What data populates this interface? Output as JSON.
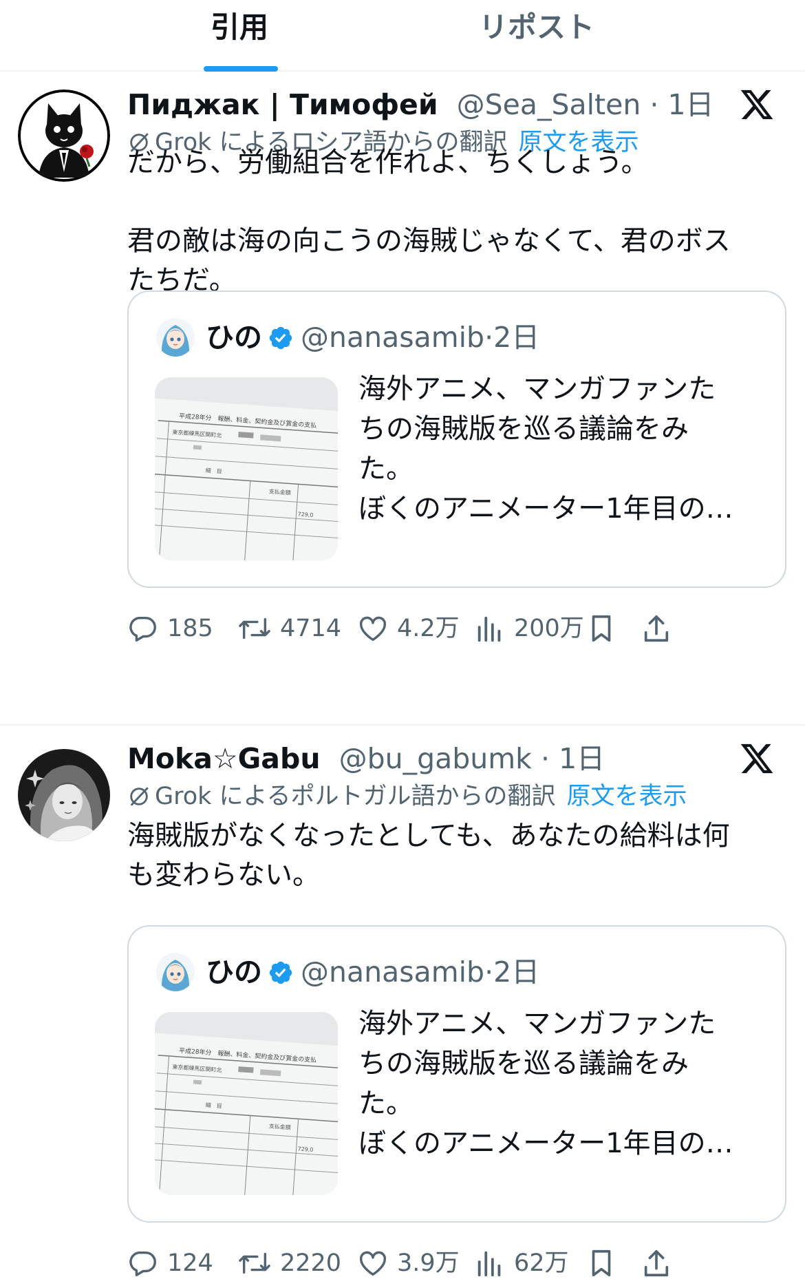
{
  "tabs": [
    {
      "label": "引用",
      "active": true
    },
    {
      "label": "リポスト",
      "active": false
    }
  ],
  "colors": {
    "accent": "#1d9bf0",
    "text": "#0f1419",
    "muted": "#536471",
    "border": "#cfd9de"
  },
  "posts": [
    {
      "display_name": "Пиджак | Тимофей",
      "handle": "@Sea_Salten",
      "dot": "·",
      "time": "1日",
      "avatar_icon": "black-cat-in-suit-avatar",
      "translation_note": "Grok によるロシア語からの翻訳",
      "show_original": "原文を表示",
      "text": "だから、労働組合を作れよ、ちくしょう。\n\n君の敵は海の向こうの海賊じゃなくて、君のボス\nたちだ。",
      "quote": {
        "name": "ひの",
        "handle": "@nanasamib",
        "dot": "·",
        "time": "2日",
        "text": "海外アニメ、マンガファンた\nちの海賊版を巡る議論をみ\nた。\nぼくのアニメーター1年目の…",
        "thumb_lines": [
          "平成28年分　報酬、料金、契約金及び賞金の支払",
          "東京都練馬区関町北",
          "細　目",
          "支払金額",
          "729,0"
        ]
      },
      "stats": {
        "replies": "185",
        "reposts": "4714",
        "likes": "4.2万",
        "views": "200万"
      }
    },
    {
      "display_name": "Moka☆Gabu",
      "handle": "@bu_gabumk",
      "dot": "·",
      "time": "1日",
      "avatar_icon": "illustrated-girl-avatar",
      "translation_note": "Grok によるポルトガル語からの翻訳",
      "show_original": "原文を表示",
      "text": "海賊版がなくなったとしても、あなたの給料は何\nも変わらない。",
      "quote": {
        "name": "ひの",
        "handle": "@nanasamib",
        "dot": "·",
        "time": "2日",
        "text": "海外アニメ、マンガファンた\nちの海賊版を巡る議論をみ\nた。\nぼくのアニメーター1年目の…",
        "thumb_lines": [
          "平成28年分　報酬、料金、契約金及び賞金の支払",
          "東京都練馬区関町北",
          "細　目",
          "支払金額",
          "729,0"
        ]
      },
      "stats": {
        "replies": "124",
        "reposts": "2220",
        "likes": "3.9万",
        "views": "62万"
      }
    }
  ]
}
